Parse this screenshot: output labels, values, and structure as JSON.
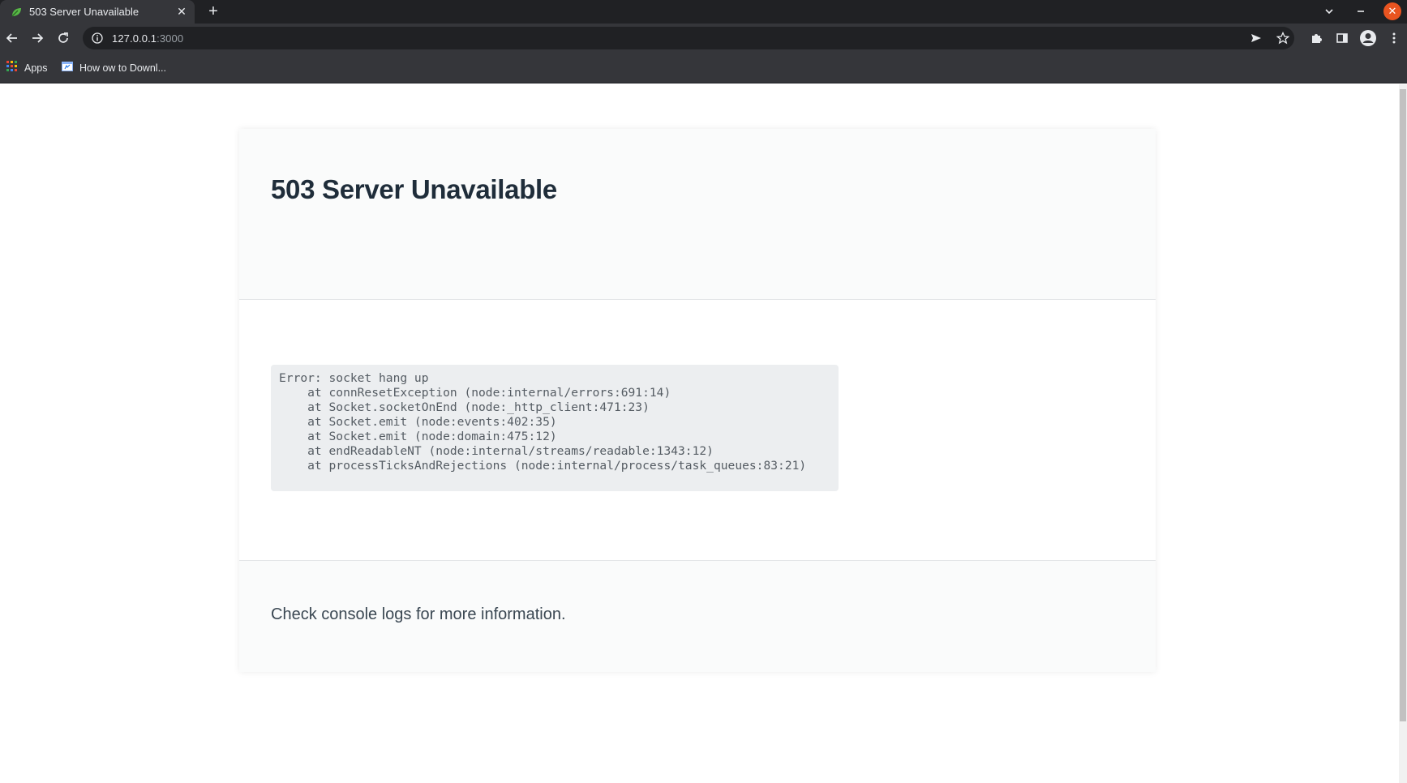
{
  "browser": {
    "tab": {
      "title": "503 Server Unavailable",
      "favicon": "leaf-icon"
    },
    "address_bar": {
      "host": "127.0.0.1",
      "port": ":3000"
    },
    "bookmarks": [
      {
        "label": "Apps",
        "icon": "apps-grid-icon"
      },
      {
        "label": "How ow to Downl...",
        "icon": "bookmark-page-icon"
      }
    ],
    "colors": {
      "chrome_dark": "#202124",
      "chrome_mid": "#35363a",
      "close_button": "#e95420"
    }
  },
  "page": {
    "title": "503 Server Unavailable",
    "stack_lines": [
      "Error: socket hang up",
      "    at connResetException (node:internal/errors:691:14)",
      "    at Socket.socketOnEnd (node:_http_client:471:23)",
      "    at Socket.emit (node:events:402:35)",
      "    at Socket.emit (node:domain:475:12)",
      "    at endReadableNT (node:internal/streams/readable:1343:12)",
      "    at processTicksAndRejections (node:internal/process/task_queues:83:21)"
    ],
    "footer_text": "Check console logs for more information.",
    "colors": {
      "heading": "#1f2d3a",
      "panel_bg": "#fafbfb",
      "code_bg": "#eceef0"
    }
  }
}
